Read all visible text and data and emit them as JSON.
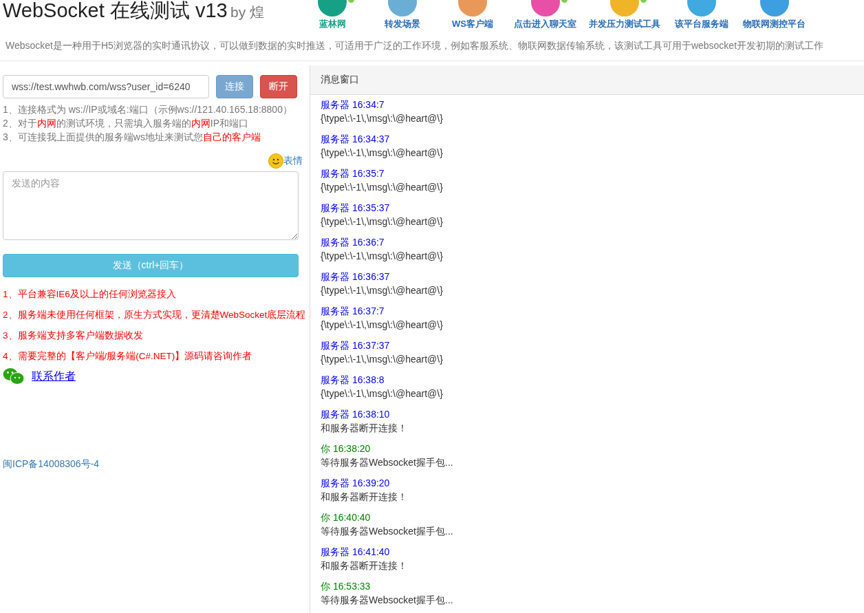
{
  "header": {
    "title": "WebSocket 在线测试 v13",
    "byline": "by 煌",
    "nav": [
      {
        "label": "蓝林网",
        "color": "#16a085",
        "badge": true
      },
      {
        "label": "转发场景",
        "color": "#6aaed6",
        "badge": false
      },
      {
        "label": "WS客户端",
        "color": "#e8995a",
        "badge": false
      },
      {
        "label": "点击进入聊天室",
        "color": "#e84fa6",
        "badge": true
      },
      {
        "label": "并发压力测试工具",
        "color": "#f0b429",
        "badge": true
      },
      {
        "label": "该平台服务端",
        "color": "#3fa9e0",
        "badge": false
      },
      {
        "label": "物联网测控平台",
        "color": "#3d9ee0",
        "badge": false
      }
    ],
    "description": "Websocket是一种用于H5浏览器的实时通讯协议，可以做到数据的实时推送，可适用于广泛的工作环境，例如客服系统、物联网数据传输系统，该测试工具可用于websocket开发初期的测试工作"
  },
  "connection": {
    "url": "wss://test.wwhwb.com/wss?user_id=6240",
    "connect_button": "连接",
    "disconnect_button": "断开"
  },
  "notes": [
    [
      {
        "text": "1、连接格式为 ws://IP或域名:端口（示例ws://121.40.165.18:8800）",
        "highlight": false
      }
    ],
    [
      {
        "text": "2、对于",
        "highlight": false
      },
      {
        "text": "内网",
        "highlight": true
      },
      {
        "text": "的测试环境，只需填入服务端的",
        "highlight": false
      },
      {
        "text": "内网",
        "highlight": true
      },
      {
        "text": "IP和端口",
        "highlight": false
      }
    ],
    [
      {
        "text": "3、可连接我上面提供的服务端ws地址来测试您",
        "highlight": false
      },
      {
        "text": "自己的客户端",
        "highlight": true
      }
    ]
  ],
  "emoji_link": "表情",
  "message_input": {
    "placeholder": "发送的内容"
  },
  "send_button": "发送（ctrl+回车）",
  "features": [
    "1、平台兼容IE6及以上的任何浏览器接入",
    "2、服务端未使用任何框架，原生方式实现，更清楚WebSocket底层流程",
    "3、服务端支持多客户端数据收发",
    "4、需要完整的【客户端/服务端(C#.NET)】源码请咨询作者"
  ],
  "contact_link": "联系作者",
  "icp": "闽ICP备14008306号-4",
  "message_panel": {
    "title": "消息窗口",
    "messages": [
      {
        "kind": "server",
        "sender": "服务器",
        "time": "16:34:7",
        "text": "{\\type\\:\\-1\\,\\msg\\:\\@heart@\\}"
      },
      {
        "kind": "server",
        "sender": "服务器",
        "time": "16:34:37",
        "text": "{\\type\\:\\-1\\,\\msg\\:\\@heart@\\}"
      },
      {
        "kind": "server",
        "sender": "服务器",
        "time": "16:35:7",
        "text": "{\\type\\:\\-1\\,\\msg\\:\\@heart@\\}"
      },
      {
        "kind": "server",
        "sender": "服务器",
        "time": "16:35:37",
        "text": "{\\type\\:\\-1\\,\\msg\\:\\@heart@\\}"
      },
      {
        "kind": "server",
        "sender": "服务器",
        "time": "16:36:7",
        "text": "{\\type\\:\\-1\\,\\msg\\:\\@heart@\\}"
      },
      {
        "kind": "server",
        "sender": "服务器",
        "time": "16:36:37",
        "text": "{\\type\\:\\-1\\,\\msg\\:\\@heart@\\}"
      },
      {
        "kind": "server",
        "sender": "服务器",
        "time": "16:37:7",
        "text": "{\\type\\:\\-1\\,\\msg\\:\\@heart@\\}"
      },
      {
        "kind": "server",
        "sender": "服务器",
        "time": "16:37:37",
        "text": "{\\type\\:\\-1\\,\\msg\\:\\@heart@\\}"
      },
      {
        "kind": "server",
        "sender": "服务器",
        "time": "16:38:8",
        "text": "{\\type\\:\\-1\\,\\msg\\:\\@heart@\\}"
      },
      {
        "kind": "server",
        "sender": "服务器",
        "time": "16:38:10",
        "text": "和服务器断开连接！"
      },
      {
        "kind": "self",
        "sender": "你",
        "time": "16:38:20",
        "text": "等待服务器Websocket握手包..."
      },
      {
        "kind": "server",
        "sender": "服务器",
        "time": "16:39:20",
        "text": "和服务器断开连接！"
      },
      {
        "kind": "self",
        "sender": "你",
        "time": "16:40:40",
        "text": "等待服务器Websocket握手包..."
      },
      {
        "kind": "server",
        "sender": "服务器",
        "time": "16:41:40",
        "text": "和服务器断开连接！"
      },
      {
        "kind": "self",
        "sender": "你",
        "time": "16:53:33",
        "text": "等待服务器Websocket握手包..."
      }
    ]
  }
}
